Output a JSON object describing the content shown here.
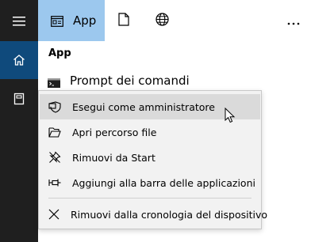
{
  "rail": {
    "items": [
      {
        "icon": "hamburger-menu-icon"
      },
      {
        "icon": "home-icon",
        "active": true
      },
      {
        "icon": "document-icon"
      }
    ],
    "accent": "#0f4a7c"
  },
  "topbar": {
    "app_tab_label": "App",
    "app_tab_icon": "app-window-icon",
    "docs_icon": "document-outline-icon",
    "web_icon": "globe-icon",
    "more_icon": "more-horizontal-icon",
    "accent": "#9cc8ee"
  },
  "results": {
    "section_title": "App",
    "items": [
      {
        "label": "Prompt dei comandi",
        "icon": "command-prompt-icon"
      }
    ]
  },
  "context_menu": {
    "items": [
      {
        "label": "Esegui come amministratore",
        "icon": "shield-icon",
        "highlighted": true
      },
      {
        "label": "Apri percorso file",
        "icon": "folder-open-icon"
      },
      {
        "label": "Rimuovi da Start",
        "icon": "unpin-icon"
      },
      {
        "label": "Aggiungi alla barra delle applicazioni",
        "icon": "pin-icon"
      },
      {
        "label": "Rimuovi dalla cronologia del dispositivo",
        "icon": "close-icon"
      }
    ]
  }
}
